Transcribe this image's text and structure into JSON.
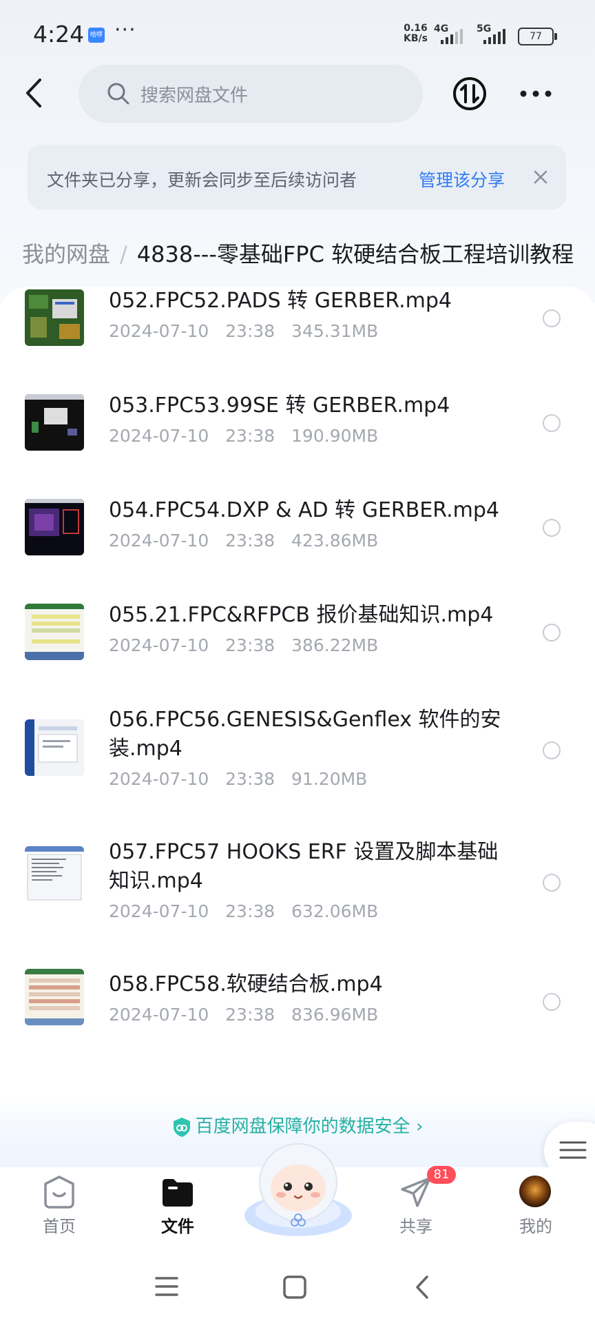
{
  "status_bar": {
    "time": "4:24",
    "app_badge": "哈啰",
    "more": "···",
    "speed_value": "0.16",
    "speed_unit": "KB/s",
    "signal1": "4G",
    "signal2": "5G",
    "battery": "77"
  },
  "header": {
    "search_placeholder": "搜索网盘文件"
  },
  "share_banner": {
    "message": "文件夹已分享，更新会同步至后续访问者",
    "manage_label": "管理该分享"
  },
  "breadcrumb": {
    "root": "我的网盘",
    "separator": "/",
    "current": "4838---零基础FPC 软硬结合板工程培训教程"
  },
  "files": [
    {
      "name": "052.FPC52.PADS 转 GERBER.mp4",
      "date": "2024-07-10",
      "time": "23:38",
      "size": "345.31MB"
    },
    {
      "name": "053.FPC53.99SE 转 GERBER.mp4",
      "date": "2024-07-10",
      "time": "23:38",
      "size": "190.90MB"
    },
    {
      "name": "054.FPC54.DXP & AD 转 GERBER.mp4",
      "date": "2024-07-10",
      "time": "23:38",
      "size": "423.86MB"
    },
    {
      "name": "055.21.FPC&RFPCB 报价基础知识.mp4",
      "date": "2024-07-10",
      "time": "23:38",
      "size": "386.22MB"
    },
    {
      "name": "056.FPC56.GENESIS&Genflex 软件的安装.mp4",
      "date": "2024-07-10",
      "time": "23:38",
      "size": "91.20MB"
    },
    {
      "name": "057.FPC57 HOOKS ERF 设置及脚本基础知识.mp4",
      "date": "2024-07-10",
      "time": "23:38",
      "size": "632.06MB"
    },
    {
      "name": "058.FPC58.软硬结合板.mp4",
      "date": "2024-07-10",
      "time": "23:38",
      "size": "836.96MB"
    }
  ],
  "security": {
    "text": "百度网盘保障你的数据安全",
    "arrow": "›"
  },
  "nav": {
    "home": "首页",
    "files": "文件",
    "share": "共享",
    "share_badge": "81",
    "me": "我的"
  },
  "colors": {
    "accent": "#2f7cf6",
    "secure": "#26b0a3",
    "badge": "#ff4d5a"
  }
}
